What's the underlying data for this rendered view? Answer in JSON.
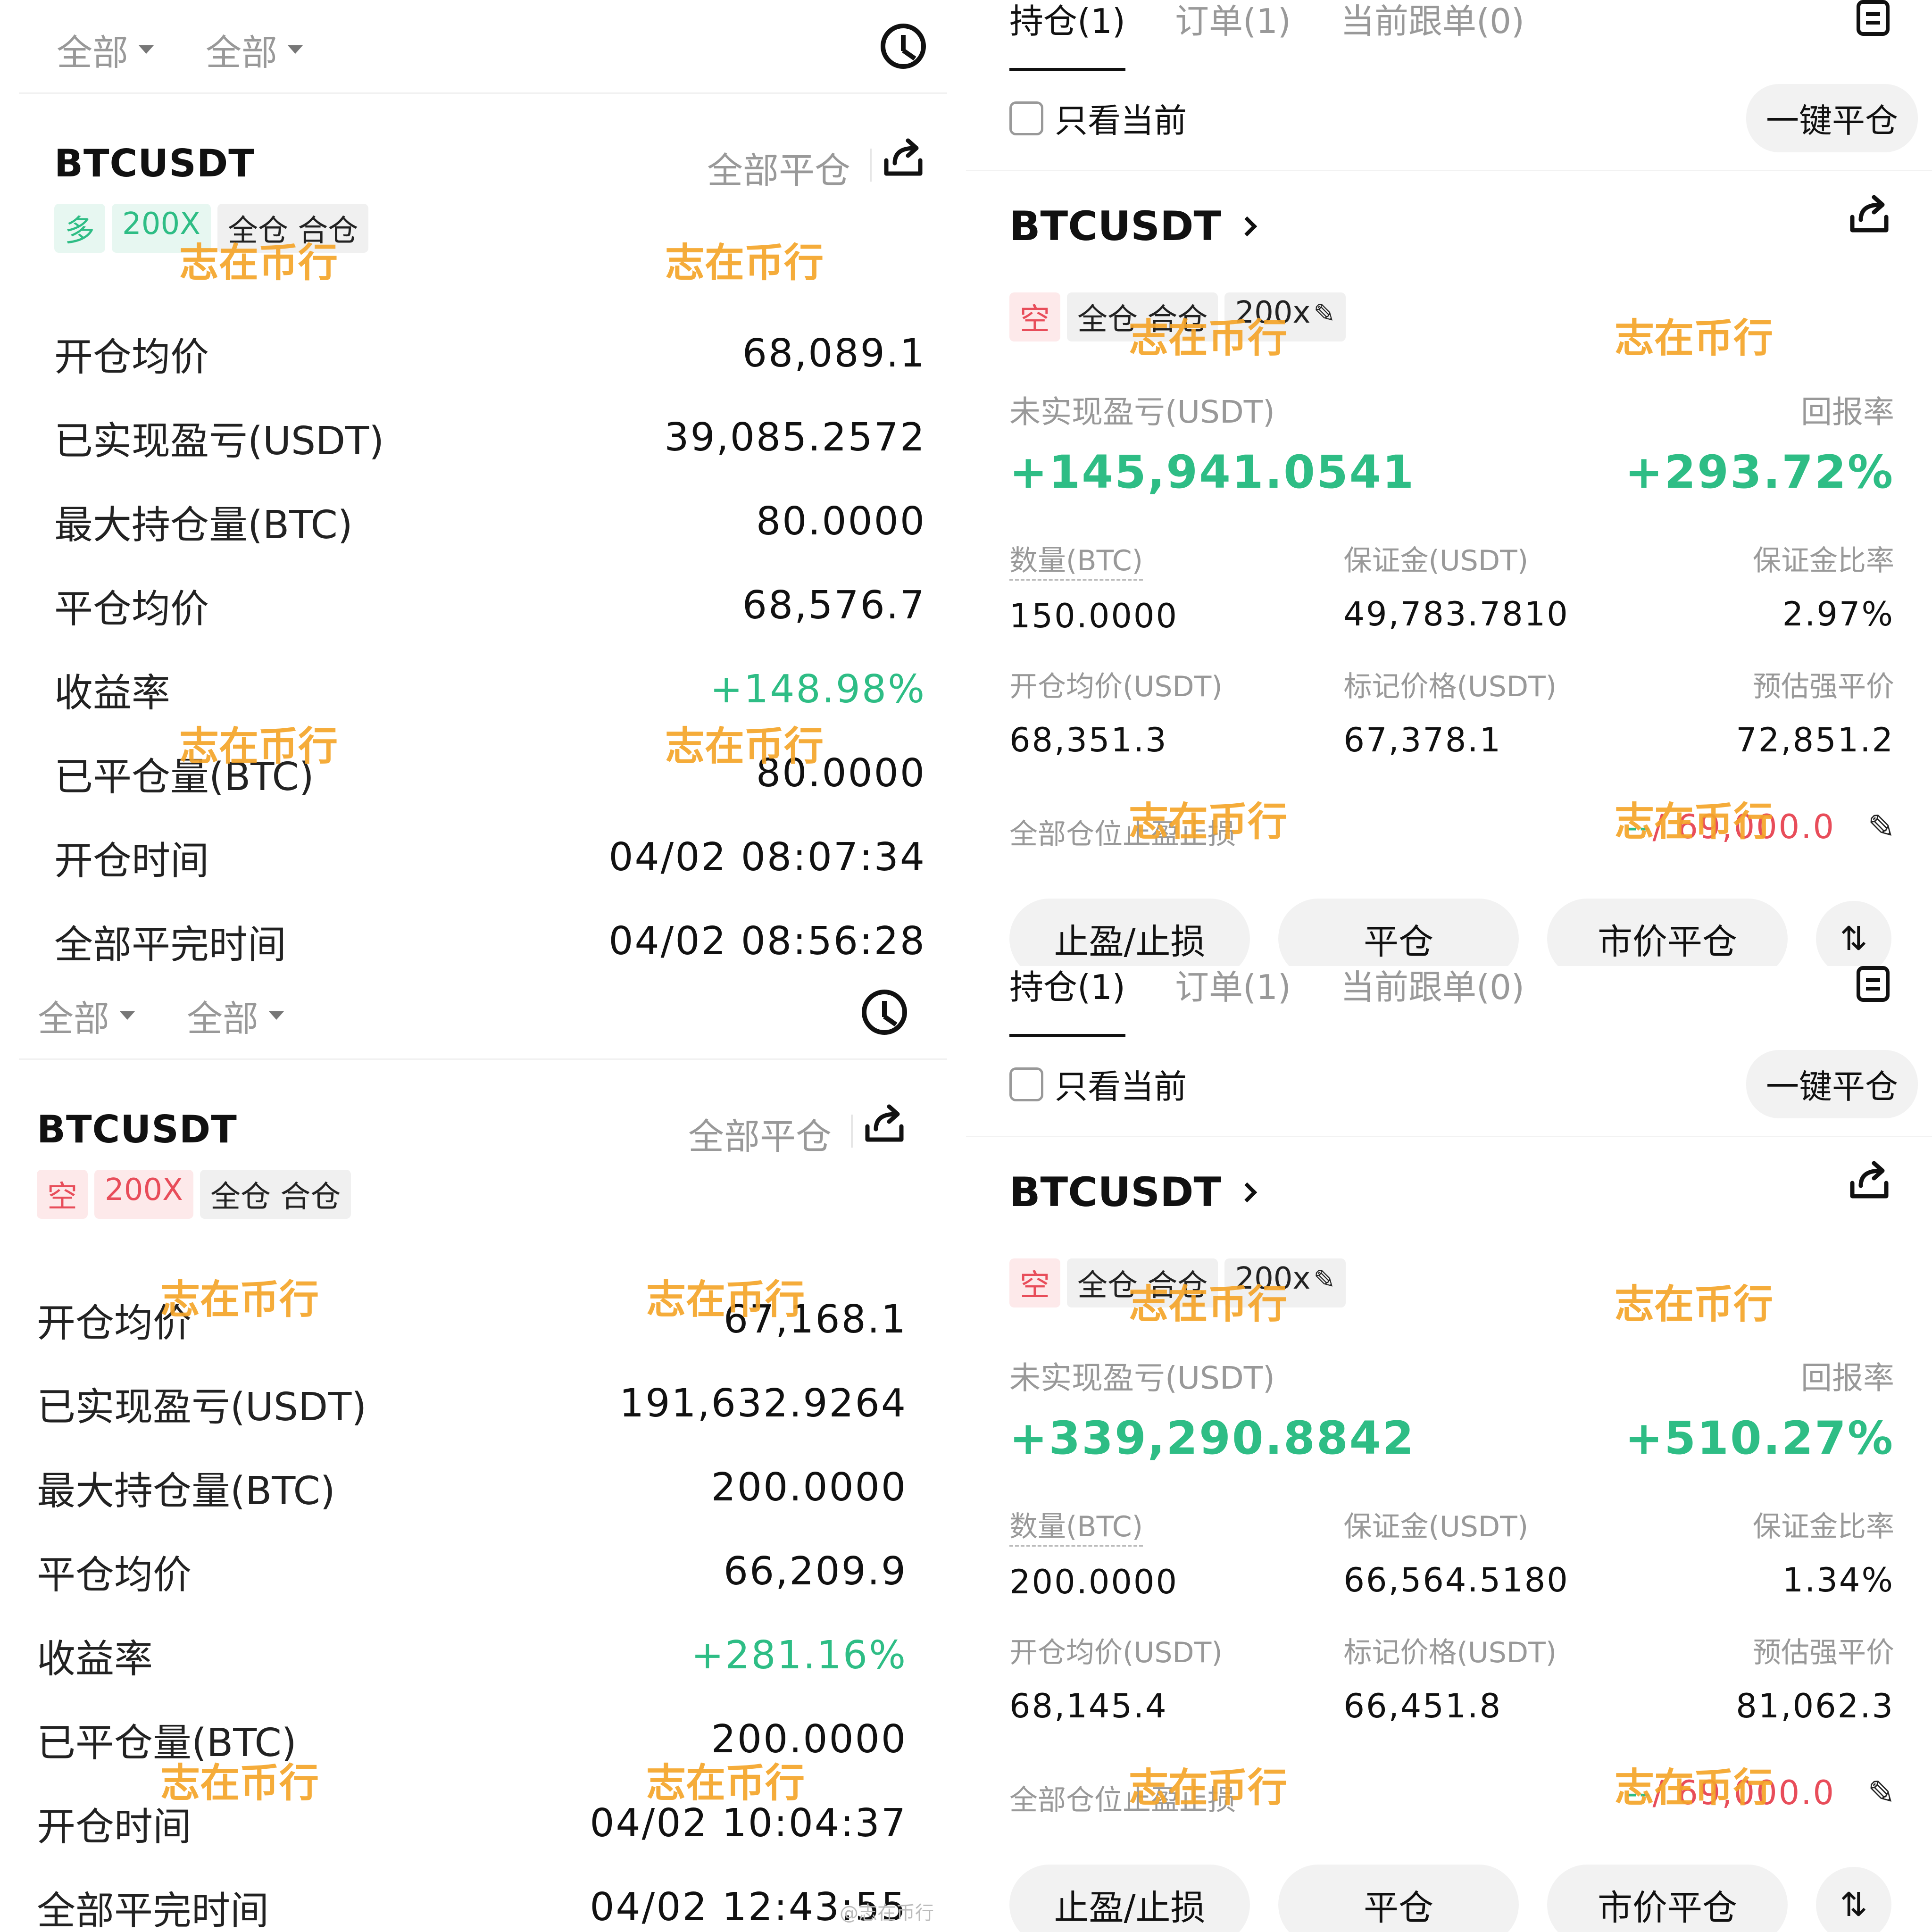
{
  "history": [
    {
      "filters": [
        "全部",
        "全部"
      ],
      "symbol": "BTCUSDT",
      "close_all": "全部平仓",
      "tags": {
        "side": "多",
        "leverage": "200X",
        "mode": "全仓 合仓"
      },
      "rows": [
        {
          "label": "开仓均价",
          "value": "68,089.1"
        },
        {
          "label": "已实现盈亏(USDT)",
          "value": "39,085.2572"
        },
        {
          "label": "最大持仓量(BTC)",
          "value": "80.0000"
        },
        {
          "label": "平仓均价",
          "value": "68,576.7"
        },
        {
          "label": "收益率",
          "value": "+148.98%"
        },
        {
          "label": "已平仓量(BTC)",
          "value": "80.0000"
        },
        {
          "label": "开仓时间",
          "value": "04/02 08:07:34"
        },
        {
          "label": "全部平完时间",
          "value": "04/02 08:56:28"
        }
      ]
    },
    {
      "filters": [
        "全部",
        "全部"
      ],
      "symbol": "BTCUSDT",
      "close_all": "全部平仓",
      "tags": {
        "side": "空",
        "leverage": "200X",
        "mode": "全仓 合仓"
      },
      "rows": [
        {
          "label": "开仓均价",
          "value": "67,168.1"
        },
        {
          "label": "已实现盈亏(USDT)",
          "value": "191,632.9264"
        },
        {
          "label": "最大持仓量(BTC)",
          "value": "200.0000"
        },
        {
          "label": "平仓均价",
          "value": "66,209.9"
        },
        {
          "label": "收益率",
          "value": "+281.16%"
        },
        {
          "label": "已平仓量(BTC)",
          "value": "200.0000"
        },
        {
          "label": "开仓时间",
          "value": "04/02 10:04:37"
        },
        {
          "label": "全部平完时间",
          "value": "04/02 12:43:55"
        }
      ]
    }
  ],
  "positions": [
    {
      "tabs": [
        "持仓(1)",
        "订单(1)",
        "当前跟单(0)"
      ],
      "only_current": "只看当前",
      "one_click_close": "一键平仓",
      "symbol": "BTCUSDT",
      "tags": {
        "side": "空",
        "mode": "全仓 合仓",
        "leverage": "200x"
      },
      "upnl_label": "未实现盈亏(USDT)",
      "roe_label": "回报率",
      "upnl": "+145,941.0541",
      "roe": "+293.72%",
      "grid": [
        [
          {
            "label": "数量(BTC)",
            "value": "150.0000"
          },
          {
            "label": "保证金(USDT)",
            "value": "49,783.7810"
          },
          {
            "label": "保证金比率",
            "value": "2.97%"
          }
        ],
        [
          {
            "label": "开仓均价(USDT)",
            "value": "68,351.3"
          },
          {
            "label": "标记价格(USDT)",
            "value": "67,378.1"
          },
          {
            "label": "预估强平价",
            "value": "72,851.2"
          }
        ]
      ],
      "tpsl_label": "全部仓位止盈止损",
      "tpsl_tp": "--",
      "tpsl_sl": "/ 69,000.0",
      "actions": [
        "止盈/止损",
        "平仓",
        "市价平仓"
      ]
    },
    {
      "tabs": [
        "持仓(1)",
        "订单(1)",
        "当前跟单(0)"
      ],
      "only_current": "只看当前",
      "one_click_close": "一键平仓",
      "symbol": "BTCUSDT",
      "tags": {
        "side": "空",
        "mode": "全仓 合仓",
        "leverage": "200x"
      },
      "upnl_label": "未实现盈亏(USDT)",
      "roe_label": "回报率",
      "upnl": "+339,290.8842",
      "roe": "+510.27%",
      "grid": [
        [
          {
            "label": "数量(BTC)",
            "value": "200.0000"
          },
          {
            "label": "保证金(USDT)",
            "value": "66,564.5180"
          },
          {
            "label": "保证金比率",
            "value": "1.34%"
          }
        ],
        [
          {
            "label": "开仓均价(USDT)",
            "value": "68,145.4"
          },
          {
            "label": "标记价格(USDT)",
            "value": "66,451.8"
          },
          {
            "label": "预估强平价",
            "value": "81,062.3"
          }
        ]
      ],
      "tpsl_label": "全部仓位止盈止损",
      "tpsl_tp": "--",
      "tpsl_sl": "/ 69,000.0",
      "actions": [
        "止盈/止损",
        "平仓",
        "市价平仓"
      ]
    }
  ],
  "watermark": "志在币行",
  "watermark_small": "@志在币行"
}
